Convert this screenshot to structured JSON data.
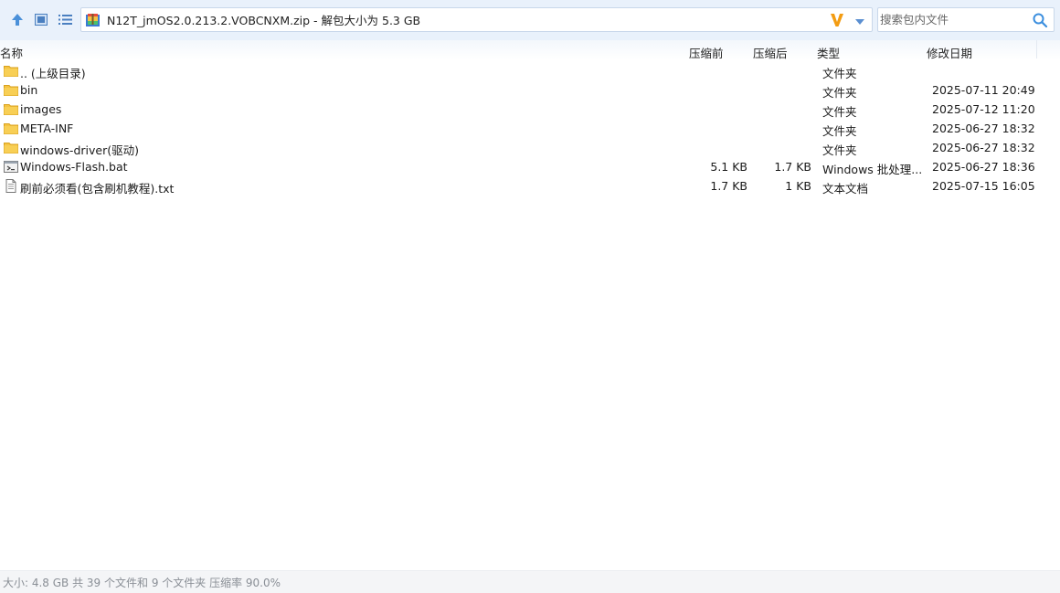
{
  "toolbar": {
    "up_icon": "arrow-up-icon",
    "thumbnail_view_icon": "thumbnail-view-icon",
    "list_view_icon": "list-view-icon"
  },
  "address": {
    "zip_icon": "zip-archive-icon",
    "path": "N12T_jmOS2.0.213.2.VOBCNXM.zip - 解包大小为 5.3 GB",
    "logo_icon": "v-logo-icon",
    "dropdown_icon": "chevron-down-icon"
  },
  "search": {
    "placeholder": "搜索包内文件",
    "icon": "search-icon"
  },
  "columns": {
    "name": "名称",
    "size_before": "压缩前",
    "size_after": "压缩后",
    "type": "类型",
    "modified": "修改日期"
  },
  "files": [
    {
      "name": ".. (上级目录)",
      "size_before": "",
      "size_after": "",
      "type": "文件夹",
      "modified": "",
      "icon": "folder-icon"
    },
    {
      "name": "bin",
      "size_before": "",
      "size_after": "",
      "type": "文件夹",
      "modified": "2025-07-11 20:49",
      "icon": "folder-icon"
    },
    {
      "name": "images",
      "size_before": "",
      "size_after": "",
      "type": "文件夹",
      "modified": "2025-07-12 11:20",
      "icon": "folder-icon"
    },
    {
      "name": "META-INF",
      "size_before": "",
      "size_after": "",
      "type": "文件夹",
      "modified": "2025-06-27 18:32",
      "icon": "folder-icon"
    },
    {
      "name": "windows-driver(驱动)",
      "size_before": "",
      "size_after": "",
      "type": "文件夹",
      "modified": "2025-06-27 18:32",
      "icon": "folder-icon"
    },
    {
      "name": "Windows-Flash.bat",
      "size_before": "5.1 KB",
      "size_after": "1.7 KB",
      "type": "Windows 批处理...",
      "modified": "2025-06-27 18:36",
      "icon": "batch-file-icon"
    },
    {
      "name": "刷前必须看(包含刷机教程).txt",
      "size_before": "1.7 KB",
      "size_after": "1 KB",
      "type": "文本文档",
      "modified": "2025-07-15 16:05",
      "icon": "text-file-icon"
    }
  ],
  "status": {
    "text": "大小: 4.8 GB 共 39 个文件和 9 个文件夹 压缩率 90.0%"
  },
  "colors": {
    "toolbar_bg": "#e9f1fb",
    "accent_blue": "#3b8ede",
    "folder_yellow": "#f5c342",
    "logo_orange": "#f39c12"
  }
}
